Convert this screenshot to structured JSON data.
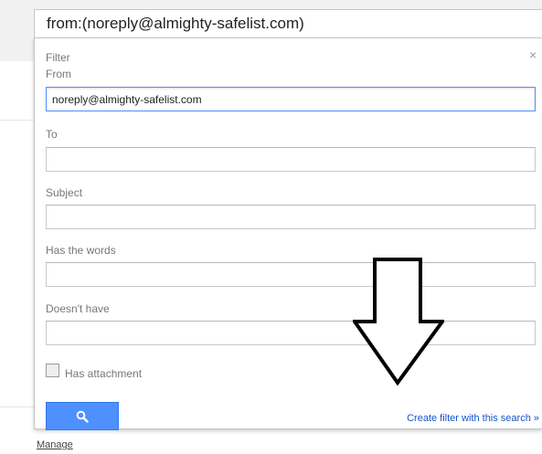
{
  "search": {
    "query": "from:(noreply@almighty-safelist.com)"
  },
  "filter_panel": {
    "title": "Filter",
    "close_icon": "×",
    "fields": {
      "from_label": "From",
      "from_value": "noreply@almighty-safelist.com",
      "to_label": "To",
      "to_value": "",
      "subject_label": "Subject",
      "subject_value": "",
      "has_words_label": "Has the words",
      "has_words_value": "",
      "doesnt_have_label": "Doesn't have",
      "doesnt_have_value": ""
    },
    "has_attachment": {
      "label": "Has attachment",
      "checked": false
    },
    "search_button_icon": "search-icon",
    "create_filter_link": "Create filter with this search »"
  },
  "annotation": {
    "arrow_icon": "down-arrow-icon"
  },
  "footer": {
    "manage_link": "Manage"
  },
  "colors": {
    "accent_blue": "#4d90fe",
    "link_blue": "#1155cc"
  }
}
